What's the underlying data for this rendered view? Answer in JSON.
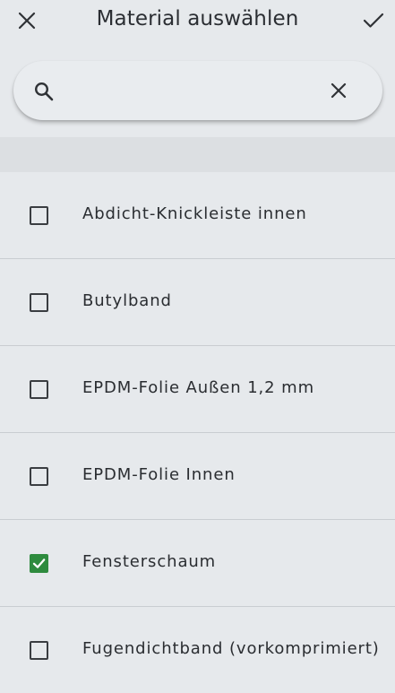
{
  "header": {
    "title": "Material auswählen",
    "close_icon": "close-icon",
    "confirm_icon": "check-icon"
  },
  "search": {
    "value": "",
    "placeholder": "",
    "search_icon": "search-icon",
    "clear_icon": "close-icon"
  },
  "colors": {
    "background": "#e6e9ec",
    "checked": "#2e8b3e",
    "divider": "#c9cdd1"
  },
  "items": [
    {
      "label": "Abdicht-Knickleiste innen",
      "checked": false
    },
    {
      "label": "Butylband",
      "checked": false
    },
    {
      "label": "EPDM-Folie Außen 1,2 mm",
      "checked": false
    },
    {
      "label": "EPDM-Folie Innen",
      "checked": false
    },
    {
      "label": "Fensterschaum",
      "checked": true
    },
    {
      "label": "Fugendichtband (vorkomprimiert)",
      "checked": false
    }
  ]
}
